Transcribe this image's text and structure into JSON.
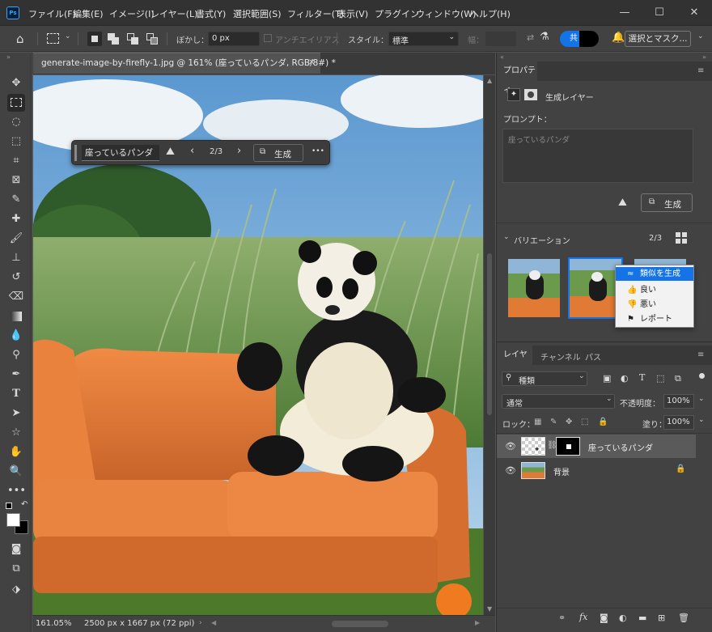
{
  "app": {
    "logo": "Ps"
  },
  "menubar": {
    "items": [
      "ファイル(F)",
      "編集(E)",
      "イメージ(I)",
      "レイヤー(L)",
      "書式(Y)",
      "選択範囲(S)",
      "フィルター(T)",
      "表示(V)",
      "プラグイン",
      "ウィンドウ(W)",
      "ヘルプ(H)"
    ]
  },
  "window_controls": {
    "minimize": "—",
    "maximize": "☐",
    "close": "✕"
  },
  "options": {
    "feather_label": "ぼかし：",
    "feather_value": "0 px",
    "antialias_label": "アンチエイリアス",
    "style_label": "スタイル：",
    "style_value": "標準",
    "width_label": "幅：",
    "share_label": "共",
    "select_mask_label": "選択とマスク..."
  },
  "document": {
    "tab_title": "generate-image-by-firefly-1.jpg @ 161% (座っているパンダ, RGB/8#) *",
    "close": "✕"
  },
  "contextual_taskbar": {
    "prompt_value": "座っているパンダ",
    "variation_counter": "2/3",
    "generate_label": "生成",
    "more": "•••"
  },
  "status": {
    "zoom": "161.05%",
    "doc_info": "2500 px x 1667 px (72 ppi)"
  },
  "properties": {
    "panel_title": "プロパティ",
    "layer_type": "生成レイヤー",
    "prompt_label": "プロンプト：",
    "prompt_placeholder": "座っているパンダ",
    "generate_label": "生成",
    "variations_label": "バリエーション",
    "variation_counter": "2/3"
  },
  "variation_menu": {
    "items": [
      {
        "icon": "≈",
        "label": "類似を生成"
      },
      {
        "icon": "👍",
        "label": "良い"
      },
      {
        "icon": "👎",
        "label": "悪い"
      },
      {
        "icon": "⚑",
        "label": "レポート"
      }
    ]
  },
  "layers_panel": {
    "tabs": [
      "レイヤー",
      "チャンネル",
      "パス"
    ],
    "filter_value": "種類",
    "blend_mode": "通常",
    "opacity_label": "不透明度：",
    "opacity_value": "100%",
    "lock_label": "ロック：",
    "fill_label": "塗り：",
    "fill_value": "100%",
    "layers": [
      {
        "name": "座っているパンダ",
        "selected": true
      },
      {
        "name": "背景",
        "locked": true
      }
    ],
    "footer_fx": "fx"
  },
  "colors": {
    "ui_dark": "#323232",
    "panel": "#424242",
    "canvas_bg": "#535353",
    "accent_blue": "#1473e6",
    "sofa_orange": "#e07a34"
  }
}
